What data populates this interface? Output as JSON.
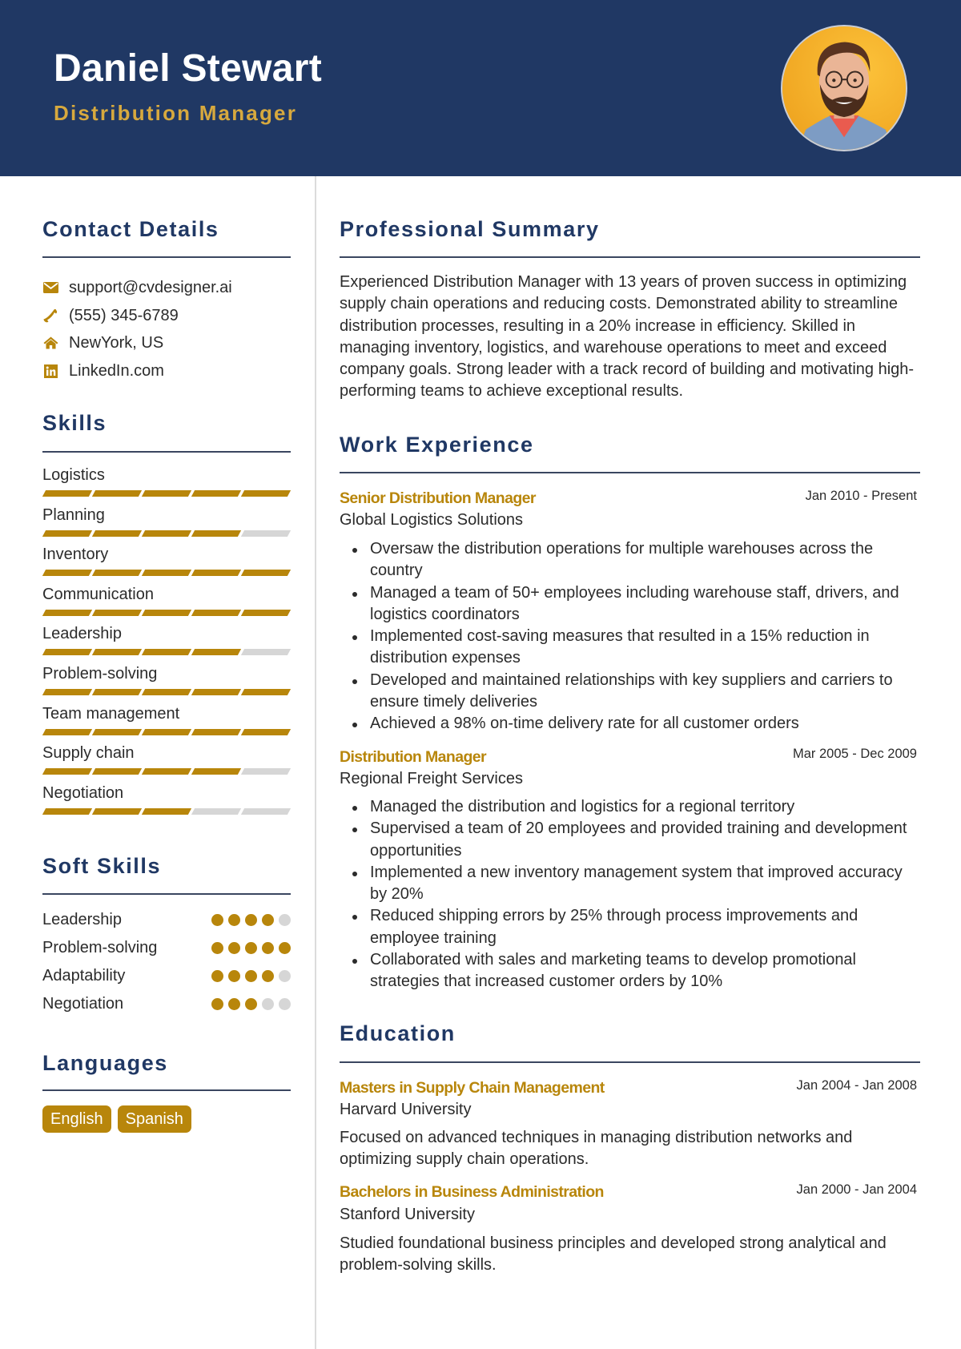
{
  "header": {
    "name": "Daniel Stewart",
    "role": "Distribution Manager",
    "photo_icon": "profile-photo"
  },
  "colors": {
    "header_bg": "#203864",
    "accent_gold": "#b8860b",
    "role_gold": "#d7a93e",
    "heading_navy": "#203864",
    "inactive_gray": "#d6d6d6"
  },
  "contact": {
    "title": "Contact Details",
    "items": [
      {
        "icon": "envelope-icon",
        "text": "support@cvdesigner.ai"
      },
      {
        "icon": "phone-icon",
        "text": "(555) 345-6789"
      },
      {
        "icon": "home-icon",
        "text": "NewYork, US"
      },
      {
        "icon": "linkedin-icon",
        "text": "LinkedIn.com"
      }
    ]
  },
  "skills": {
    "title": "Skills",
    "max": 5,
    "items": [
      {
        "label": "Logistics",
        "level": 5
      },
      {
        "label": "Planning",
        "level": 4
      },
      {
        "label": "Inventory",
        "level": 5
      },
      {
        "label": "Communication",
        "level": 5
      },
      {
        "label": "Leadership",
        "level": 4
      },
      {
        "label": "Problem-solving",
        "level": 5
      },
      {
        "label": "Team management",
        "level": 5
      },
      {
        "label": "Supply chain",
        "level": 4
      },
      {
        "label": "Negotiation",
        "level": 3
      }
    ]
  },
  "soft_skills": {
    "title": "Soft Skills",
    "max": 5,
    "items": [
      {
        "label": "Leadership",
        "level": 4
      },
      {
        "label": "Problem-solving",
        "level": 5
      },
      {
        "label": "Adaptability",
        "level": 4
      },
      {
        "label": "Negotiation",
        "level": 3
      }
    ]
  },
  "languages": {
    "title": "Languages",
    "items": [
      "English",
      "Spanish"
    ]
  },
  "summary": {
    "title": "Professional Summary",
    "text": "Experienced Distribution Manager with 13 years of proven success in optimizing supply chain operations and reducing costs. Demonstrated ability to streamline distribution processes, resulting in a 20% increase in efficiency. Skilled in managing inventory, logistics, and warehouse operations to meet and exceed company goals. Strong leader with a track record of building and motivating high-performing teams to achieve exceptional results."
  },
  "experience": {
    "title": "Work Experience",
    "jobs": [
      {
        "title": "Senior Distribution Manager",
        "dates": "Jan 2010 - Present",
        "company": "Global Logistics Solutions",
        "bullets": [
          "Oversaw the distribution operations for multiple warehouses across the country",
          "Managed a team of 50+ employees including warehouse staff, drivers, and logistics coordinators",
          "Implemented cost-saving measures that resulted in a 15% reduction in distribution expenses",
          "Developed and maintained relationships with key suppliers and carriers to ensure timely deliveries",
          "Achieved a 98% on-time delivery rate for all customer orders"
        ]
      },
      {
        "title": "Distribution Manager",
        "dates": "Mar 2005 - Dec 2009",
        "company": "Regional Freight Services",
        "bullets": [
          "Managed the distribution and logistics for a regional territory",
          "Supervised a team of 20 employees and provided training and development opportunities",
          "Implemented a new inventory management system that improved accuracy by 20%",
          "Reduced shipping errors by 25% through process improvements and employee training",
          "Collaborated with sales and marketing teams to develop promotional strategies that increased customer orders by 10%"
        ]
      }
    ]
  },
  "education": {
    "title": "Education",
    "items": [
      {
        "degree": "Masters in Supply Chain Management",
        "dates": "Jan 2004 - Jan 2008",
        "school": "Harvard University",
        "description": "Focused on advanced techniques in managing distribution networks and optimizing supply chain operations."
      },
      {
        "degree": "Bachelors in Business Administration",
        "dates": "Jan 2000 - Jan 2004",
        "school": "Stanford University",
        "description": "Studied foundational business principles and developed strong analytical and problem-solving skills."
      }
    ]
  }
}
